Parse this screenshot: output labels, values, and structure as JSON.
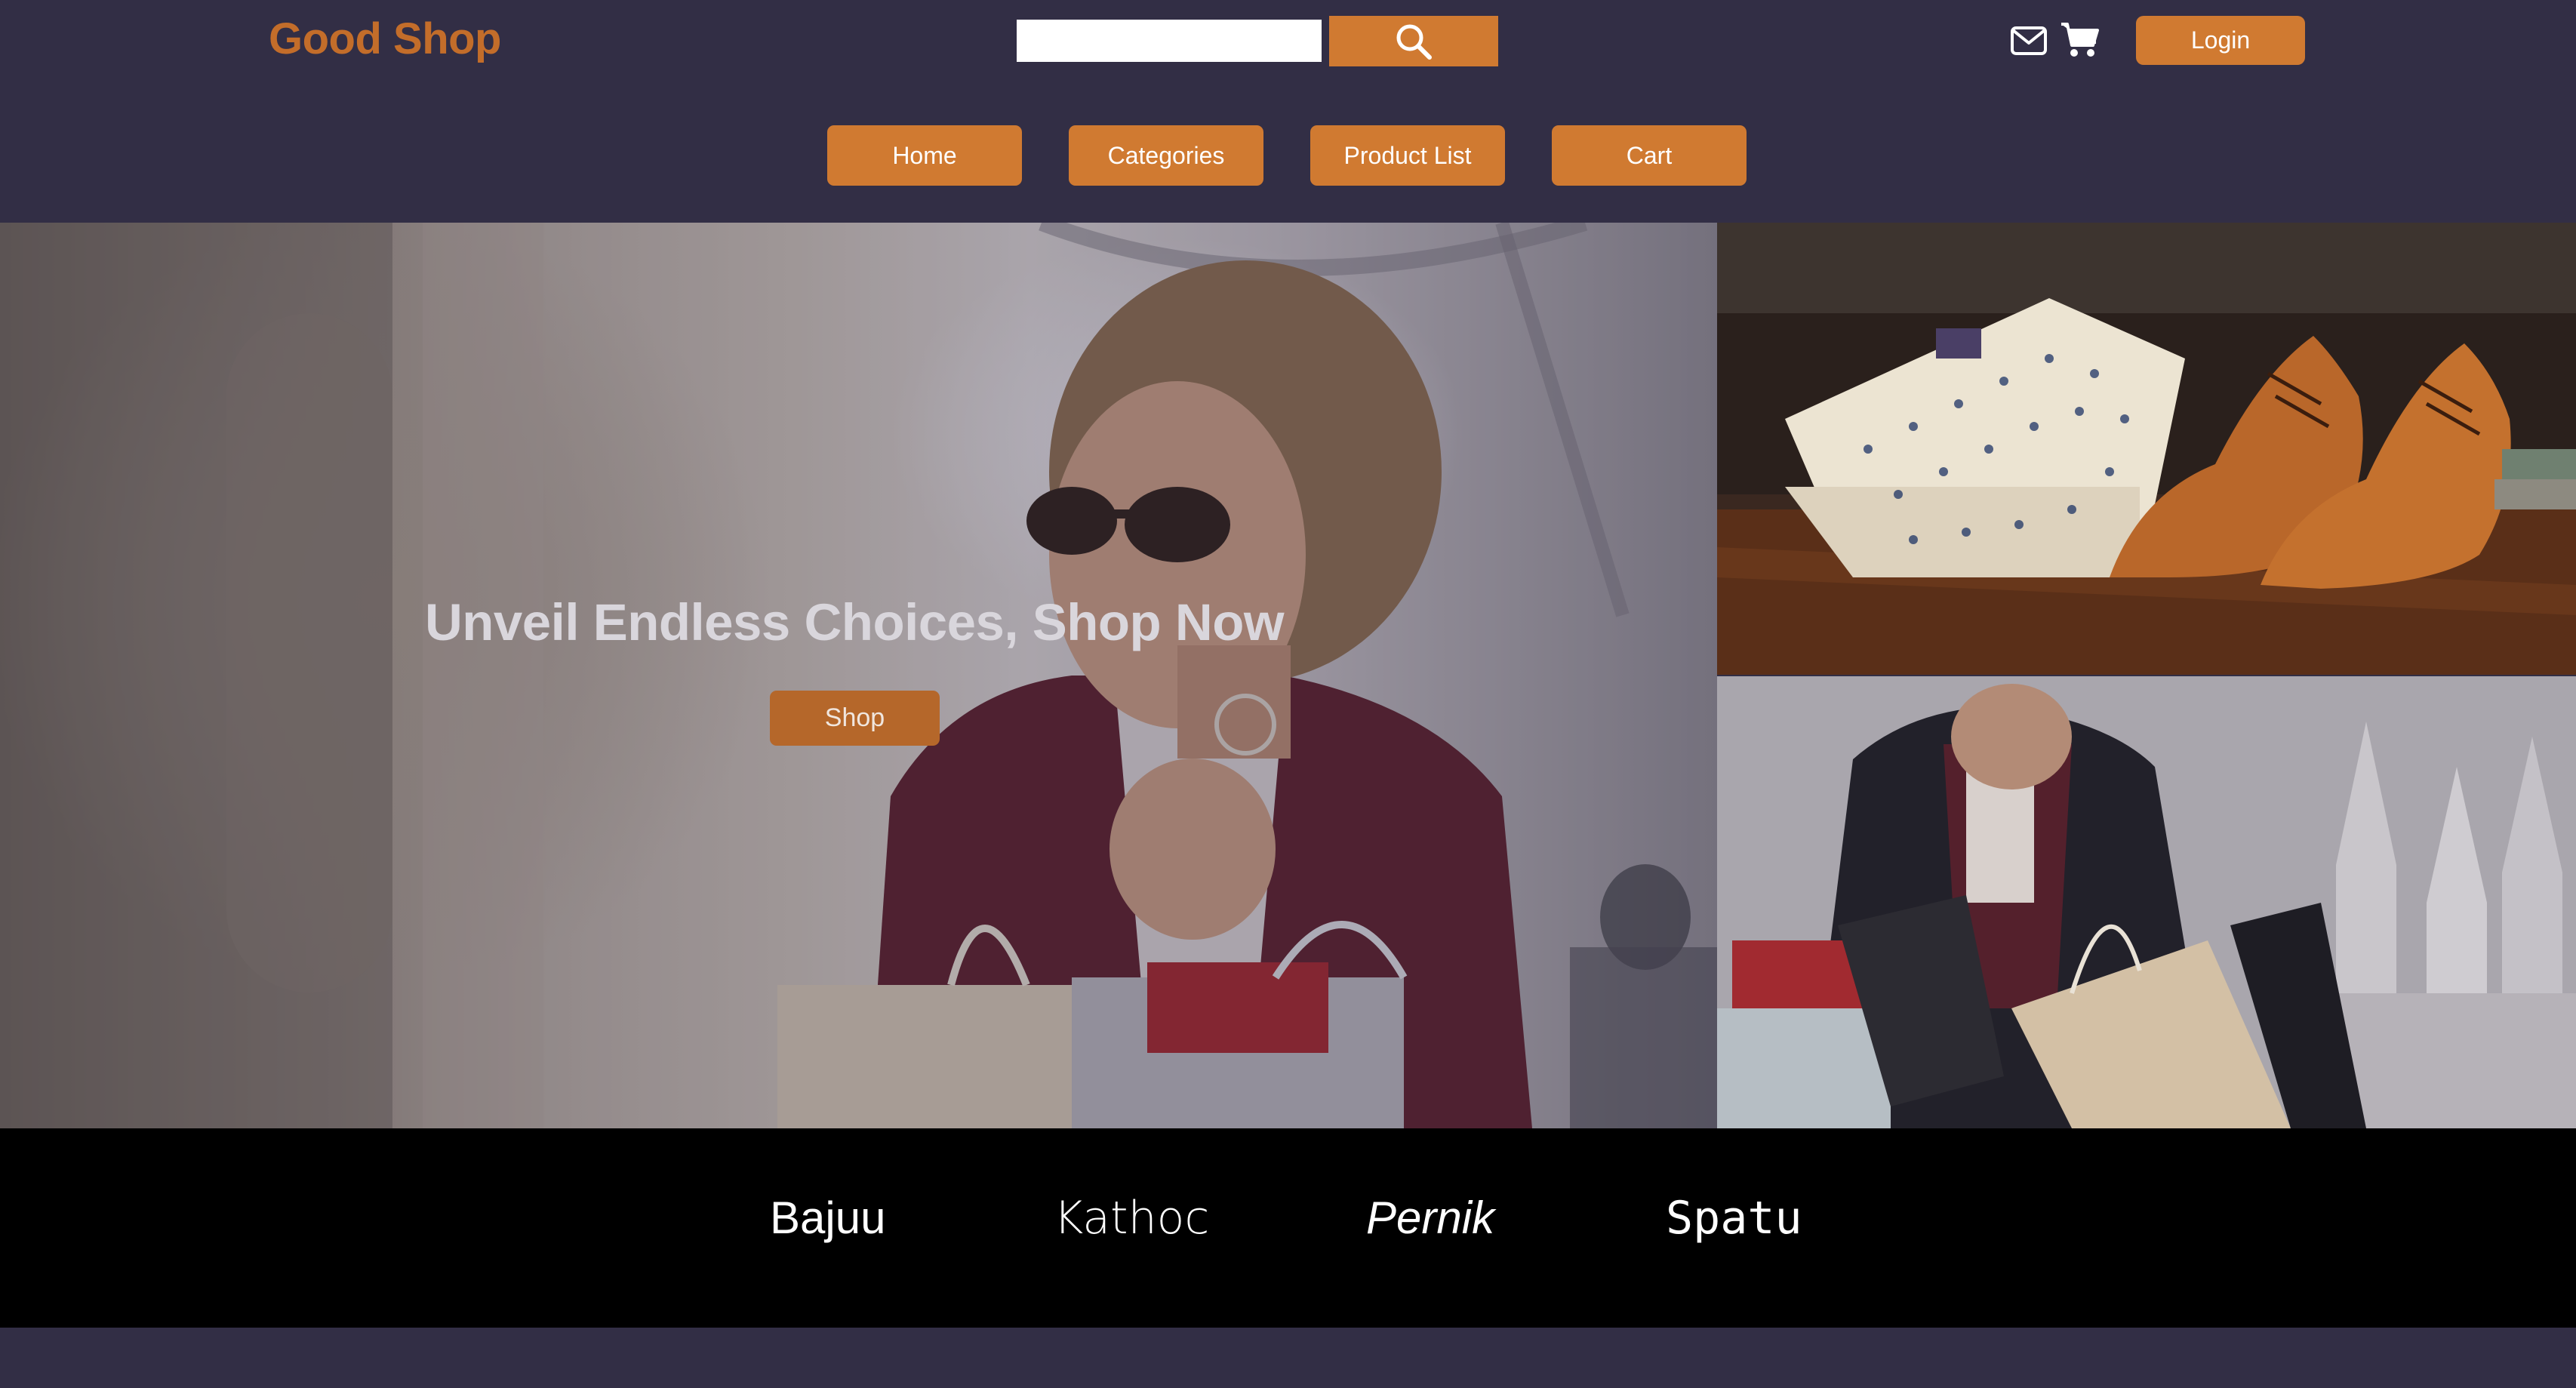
{
  "header": {
    "logo": "Good Shop",
    "search": {
      "value": "",
      "placeholder": ""
    },
    "search_icon": "search-icon",
    "mail_icon": "envelope-icon",
    "cart_icon": "shopping-cart-icon",
    "login_label": "Login"
  },
  "nav": {
    "items": [
      {
        "label": "Home"
      },
      {
        "label": "Categories"
      },
      {
        "label": "Product List"
      },
      {
        "label": "Cart"
      }
    ]
  },
  "hero": {
    "title": "Unveil Endless Choices, Shop Now",
    "cta_label": "Shop"
  },
  "brands": [
    "Bajuu",
    "Kathoc",
    "Pernik",
    "Spatu"
  ],
  "colors": {
    "background": "#322e45",
    "accent": "#d07a31",
    "logo": "#c36d2a",
    "brand_bar": "#000000"
  }
}
